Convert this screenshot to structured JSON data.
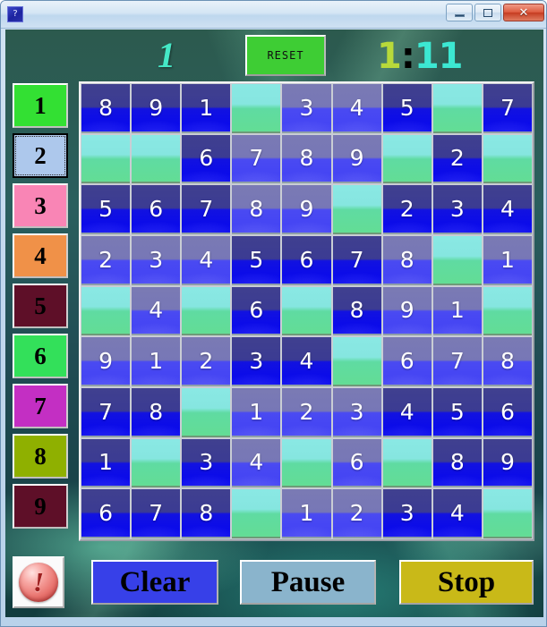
{
  "window": {
    "title": "",
    "icon": "sudoku-app-icon",
    "controls": {
      "minimize": "minimize-icon",
      "maximize": "maximize-icon",
      "close": "✕"
    }
  },
  "header": {
    "level_label": "1",
    "reset_label": "RESET",
    "timer": {
      "full": "1:11",
      "minutes": "1",
      "separator": ":",
      "seconds": "11",
      "minutes_color": "#b8d93a",
      "separator_color": "#000000",
      "seconds_color": "#3ce8d2"
    }
  },
  "sidebar": {
    "items": [
      {
        "label": "1",
        "color": "#33e033",
        "selected": false
      },
      {
        "label": "2",
        "color": "#adc8ec",
        "selected": true
      },
      {
        "label": "3",
        "color": "#f985b5",
        "selected": false
      },
      {
        "label": "4",
        "color": "#f09148",
        "selected": false
      },
      {
        "label": "5",
        "color": "#5e0f28",
        "selected": false
      },
      {
        "label": "6",
        "color": "#33e05a",
        "selected": false
      },
      {
        "label": "7",
        "color": "#c32fc3",
        "selected": false
      },
      {
        "label": "8",
        "color": "#8fb000",
        "selected": false
      },
      {
        "label": "9",
        "color": "#5e0f28",
        "selected": false
      }
    ]
  },
  "grid": {
    "rows": 9,
    "cols": 9,
    "cell_styles": {
      "dark": "given-dark-blue",
      "light": "editable-periwinkle",
      "empty": "empty-cyan-green"
    },
    "cells": [
      [
        {
          "v": "8",
          "s": "dark"
        },
        {
          "v": "9",
          "s": "dark"
        },
        {
          "v": "1",
          "s": "dark"
        },
        {
          "v": "",
          "s": "empty"
        },
        {
          "v": "3",
          "s": "light"
        },
        {
          "v": "4",
          "s": "light"
        },
        {
          "v": "5",
          "s": "dark"
        },
        {
          "v": "",
          "s": "empty"
        },
        {
          "v": "7",
          "s": "dark"
        }
      ],
      [
        {
          "v": "",
          "s": "empty"
        },
        {
          "v": "",
          "s": "empty"
        },
        {
          "v": "6",
          "s": "dark"
        },
        {
          "v": "7",
          "s": "light"
        },
        {
          "v": "8",
          "s": "light"
        },
        {
          "v": "9",
          "s": "light"
        },
        {
          "v": "",
          "s": "empty"
        },
        {
          "v": "2",
          "s": "dark"
        },
        {
          "v": "",
          "s": "empty"
        }
      ],
      [
        {
          "v": "5",
          "s": "dark"
        },
        {
          "v": "6",
          "s": "dark"
        },
        {
          "v": "7",
          "s": "dark"
        },
        {
          "v": "8",
          "s": "light"
        },
        {
          "v": "9",
          "s": "light"
        },
        {
          "v": "",
          "s": "empty"
        },
        {
          "v": "2",
          "s": "dark"
        },
        {
          "v": "3",
          "s": "dark"
        },
        {
          "v": "4",
          "s": "dark"
        }
      ],
      [
        {
          "v": "2",
          "s": "light"
        },
        {
          "v": "3",
          "s": "light"
        },
        {
          "v": "4",
          "s": "light"
        },
        {
          "v": "5",
          "s": "dark"
        },
        {
          "v": "6",
          "s": "dark"
        },
        {
          "v": "7",
          "s": "dark"
        },
        {
          "v": "8",
          "s": "light"
        },
        {
          "v": "",
          "s": "empty"
        },
        {
          "v": "1",
          "s": "light"
        }
      ],
      [
        {
          "v": "",
          "s": "empty"
        },
        {
          "v": "4",
          "s": "light"
        },
        {
          "v": "",
          "s": "empty"
        },
        {
          "v": "6",
          "s": "dark"
        },
        {
          "v": "",
          "s": "empty"
        },
        {
          "v": "8",
          "s": "dark"
        },
        {
          "v": "9",
          "s": "light"
        },
        {
          "v": "1",
          "s": "light"
        },
        {
          "v": "",
          "s": "empty"
        }
      ],
      [
        {
          "v": "9",
          "s": "light"
        },
        {
          "v": "1",
          "s": "light"
        },
        {
          "v": "2",
          "s": "light"
        },
        {
          "v": "3",
          "s": "dark"
        },
        {
          "v": "4",
          "s": "dark"
        },
        {
          "v": "",
          "s": "empty"
        },
        {
          "v": "6",
          "s": "light"
        },
        {
          "v": "7",
          "s": "light"
        },
        {
          "v": "8",
          "s": "light"
        }
      ],
      [
        {
          "v": "7",
          "s": "dark"
        },
        {
          "v": "8",
          "s": "dark"
        },
        {
          "v": "",
          "s": "empty"
        },
        {
          "v": "1",
          "s": "light"
        },
        {
          "v": "2",
          "s": "light"
        },
        {
          "v": "3",
          "s": "light"
        },
        {
          "v": "4",
          "s": "dark"
        },
        {
          "v": "5",
          "s": "dark"
        },
        {
          "v": "6",
          "s": "dark"
        }
      ],
      [
        {
          "v": "1",
          "s": "dark"
        },
        {
          "v": "",
          "s": "empty"
        },
        {
          "v": "3",
          "s": "dark"
        },
        {
          "v": "4",
          "s": "light"
        },
        {
          "v": "",
          "s": "empty"
        },
        {
          "v": "6",
          "s": "light"
        },
        {
          "v": "",
          "s": "empty"
        },
        {
          "v": "8",
          "s": "dark"
        },
        {
          "v": "9",
          "s": "dark"
        }
      ],
      [
        {
          "v": "6",
          "s": "dark"
        },
        {
          "v": "7",
          "s": "dark"
        },
        {
          "v": "8",
          "s": "dark"
        },
        {
          "v": "",
          "s": "empty"
        },
        {
          "v": "1",
          "s": "light"
        },
        {
          "v": "2",
          "s": "light"
        },
        {
          "v": "3",
          "s": "dark"
        },
        {
          "v": "4",
          "s": "dark"
        },
        {
          "v": "",
          "s": "empty"
        }
      ]
    ]
  },
  "bottom": {
    "alert_icon": "red-exclamation-icon",
    "clear_label": "Clear",
    "pause_label": "Pause",
    "stop_label": "Stop",
    "clear_color": "#3740e8",
    "pause_color": "#8ab4cc",
    "stop_color": "#c9b918"
  }
}
